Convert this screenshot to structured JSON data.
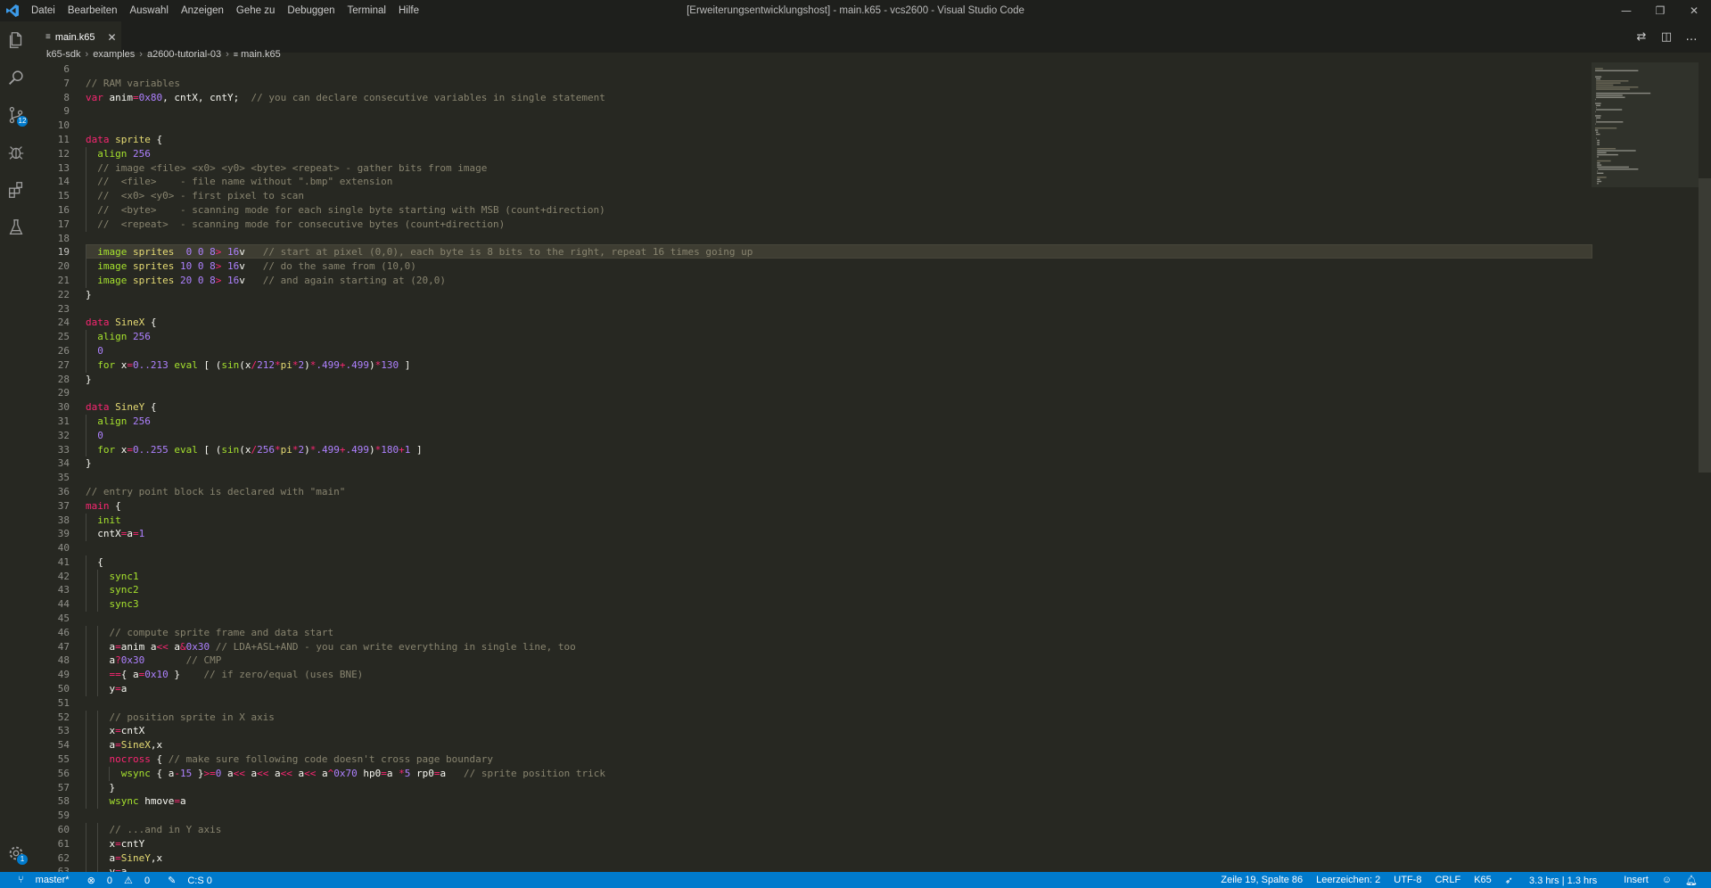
{
  "titlebar": {
    "menu": [
      "Datei",
      "Bearbeiten",
      "Auswahl",
      "Anzeigen",
      "Gehe zu",
      "Debuggen",
      "Terminal",
      "Hilfe"
    ],
    "window_title": "[Erweiterungsentwicklungshost] - main.k65 - vcs2600 - Visual Studio Code",
    "controls": {
      "minimize": "—",
      "restore": "❐",
      "close": "✕"
    }
  },
  "activity": {
    "scm_badge": "12",
    "settings_badge": "1"
  },
  "tabs": [
    {
      "label": "main.k65",
      "close": "✕"
    }
  ],
  "breadcrumb": [
    "k65-sdk",
    "examples",
    "a2600-tutorial-03",
    "main.k65"
  ],
  "editor": {
    "active_line": 19,
    "lines": [
      {
        "n": "6",
        "t": ""
      },
      {
        "n": "7",
        "t": "// RAM variables"
      },
      {
        "n": "8",
        "t": "var anim=0x80, cntX, cntY;  // you can declare consecutive variables in single statement"
      },
      {
        "n": "9",
        "t": ""
      },
      {
        "n": "10",
        "t": ""
      },
      {
        "n": "11",
        "t": "data sprite {"
      },
      {
        "n": "12",
        "t": "  align 256"
      },
      {
        "n": "13",
        "t": "  // image <file> <x0> <y0> <byte> <repeat> - gather bits from image"
      },
      {
        "n": "14",
        "t": "  //  <file>    - file name without \".bmp\" extension"
      },
      {
        "n": "15",
        "t": "  //  <x0> <y0> - first pixel to scan"
      },
      {
        "n": "16",
        "t": "  //  <byte>    - scanning mode for each single byte starting with MSB (count+direction)"
      },
      {
        "n": "17",
        "t": "  //  <repeat>  - scanning mode for consecutive bytes (count+direction)"
      },
      {
        "n": "18",
        "t": ""
      },
      {
        "n": "19",
        "t": "  image sprites  0 0 8> 16v   // start at pixel (0,0), each byte is 8 bits to the right, repeat 16 times going up"
      },
      {
        "n": "20",
        "t": "  image sprites 10 0 8> 16v   // do the same from (10,0)"
      },
      {
        "n": "21",
        "t": "  image sprites 20 0 8> 16v   // and again starting at (20,0)"
      },
      {
        "n": "22",
        "t": "}"
      },
      {
        "n": "23",
        "t": ""
      },
      {
        "n": "24",
        "t": "data SineX {"
      },
      {
        "n": "25",
        "t": "  align 256"
      },
      {
        "n": "26",
        "t": "  0"
      },
      {
        "n": "27",
        "t": "  for x=0..213 eval [ (sin(x/212*pi*2)*.499+.499)*130 ]"
      },
      {
        "n": "28",
        "t": "}"
      },
      {
        "n": "29",
        "t": ""
      },
      {
        "n": "30",
        "t": "data SineY {"
      },
      {
        "n": "31",
        "t": "  align 256"
      },
      {
        "n": "32",
        "t": "  0"
      },
      {
        "n": "33",
        "t": "  for x=0..255 eval [ (sin(x/256*pi*2)*.499+.499)*180+1 ]"
      },
      {
        "n": "34",
        "t": "}"
      },
      {
        "n": "35",
        "t": ""
      },
      {
        "n": "36",
        "t": "// entry point block is declared with \"main\""
      },
      {
        "n": "37",
        "t": "main {"
      },
      {
        "n": "38",
        "t": "  init"
      },
      {
        "n": "39",
        "t": "  cntX=a=1"
      },
      {
        "n": "40",
        "t": ""
      },
      {
        "n": "41",
        "t": "  {"
      },
      {
        "n": "42",
        "t": "    sync1"
      },
      {
        "n": "43",
        "t": "    sync2"
      },
      {
        "n": "44",
        "t": "    sync3"
      },
      {
        "n": "45",
        "t": ""
      },
      {
        "n": "46",
        "t": "    // compute sprite frame and data start"
      },
      {
        "n": "47",
        "t": "    a=anim a<< a&0x30 // LDA+ASL+AND - you can write everything in single line, too"
      },
      {
        "n": "48",
        "t": "    a?0x30       // CMP"
      },
      {
        "n": "49",
        "t": "    =={ a=0x10 }    // if zero/equal (uses BNE)"
      },
      {
        "n": "50",
        "t": "    y=a"
      },
      {
        "n": "51",
        "t": ""
      },
      {
        "n": "52",
        "t": "    // position sprite in X axis"
      },
      {
        "n": "53",
        "t": "    x=cntX"
      },
      {
        "n": "54",
        "t": "    a=SineX,x"
      },
      {
        "n": "55",
        "t": "    nocross { // make sure following code doesn't cross page boundary"
      },
      {
        "n": "56",
        "t": "      wsync { a-15 }>=0 a<< a<< a<< a<< a^0x70 hp0=a *5 rp0=a   // sprite position trick"
      },
      {
        "n": "57",
        "t": "    }"
      },
      {
        "n": "58",
        "t": "    wsync hmove=a"
      },
      {
        "n": "59",
        "t": ""
      },
      {
        "n": "60",
        "t": "    // ...and in Y axis"
      },
      {
        "n": "61",
        "t": "    x=cntY"
      },
      {
        "n": "62",
        "t": "    a=SineY,x"
      },
      {
        "n": "63",
        "t": "    y=a"
      }
    ]
  },
  "statusbar": {
    "branch": "master*",
    "errors": "0",
    "warnings": "0",
    "cs": "C:S 0",
    "position": "Zeile 19, Spalte 86",
    "spaces": "Leerzeichen: 2",
    "encoding": "UTF-8",
    "eol": "CRLF",
    "language": "K65",
    "time": "3.3 hrs | 1.3 hrs",
    "mode": "Insert"
  },
  "colors": {
    "editor_bg": "#272822",
    "titlebar_bg": "#1e1f1c",
    "statusbar_bg": "#007acc",
    "comment": "#88846f",
    "keyword": "#f92672",
    "number": "#ae81ff"
  },
  "icons": [
    "vscode-logo-icon",
    "files-icon",
    "search-icon",
    "source-control-icon",
    "debug-icon",
    "extensions-icon",
    "test-flask-icon",
    "settings-gear-icon",
    "file-icon",
    "close-icon",
    "branch-icon",
    "error-icon",
    "warning-icon",
    "pencil-icon",
    "rocket-icon",
    "smiley-icon",
    "bell-icon",
    "split-editor-icon",
    "more-icon",
    "compare-icon"
  ]
}
